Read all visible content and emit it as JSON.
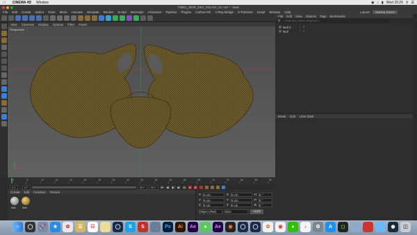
{
  "macos_menubar": {
    "app_name": "CINEMA 4D",
    "items": [
      "Window"
    ],
    "clock": "Wed 20:29"
  },
  "window": {
    "title": "TIME1_MOR_DEX_PELVIS_01.c4d * - Main"
  },
  "menu": {
    "items": [
      "File",
      "Edit",
      "Create",
      "Select",
      "Tools",
      "Mesh",
      "Animate",
      "Simulate",
      "Render",
      "Sculpt",
      "MoGraph",
      "Character",
      "Pipeline",
      "Plugins",
      "Carbon RE",
      "V-Ray Bridge",
      "X-Particles",
      "Script",
      "Window",
      "Help"
    ],
    "layout_label": "Layout:",
    "layout_value": "Startup (User)"
  },
  "viewport": {
    "menu": [
      "View",
      "Cameras",
      "Display",
      "Options",
      "Filter",
      "Panel"
    ],
    "camera_label": "Perspective",
    "bone_color": "#5a4a22",
    "background_top": "#4c4c4c",
    "background_bottom": "#616161"
  },
  "timeline": {
    "ticks": [
      "0",
      "5",
      "10",
      "15",
      "20",
      "25",
      "30",
      "35",
      "40",
      "45",
      "50",
      "55",
      "60",
      "65",
      "70",
      "75",
      "80",
      "85",
      "90"
    ],
    "current_frame": "0 F",
    "start_frame": "0 F",
    "end_frame": "90 F",
    "min_field": "0 F",
    "max_field": "90 F"
  },
  "material_manager": {
    "menu": [
      "Create",
      "Edit",
      "Function",
      "Texture"
    ],
    "materials": [
      {
        "label": "Mat",
        "color": "#9a9a9a"
      },
      {
        "label": "Mat",
        "color": "#c8a04a"
      }
    ]
  },
  "coordinates": {
    "rows": [
      {
        "axis": "X",
        "pos": "0 cm",
        "axis2": "X",
        "size": "0 cm",
        "axis3": "H",
        "rot": "0 °"
      },
      {
        "axis": "Y",
        "pos": "0 cm",
        "axis2": "Y",
        "size": "0 cm",
        "axis3": "P",
        "rot": "0 °"
      },
      {
        "axis": "Z",
        "pos": "0 cm",
        "axis2": "Z",
        "size": "0 cm",
        "axis3": "B",
        "rot": "0 °"
      }
    ],
    "mode1": "Object (Rel)",
    "mode2": "Size",
    "apply_label": "Apply"
  },
  "object_manager": {
    "menu": [
      "File",
      "Edit",
      "View",
      "Objects",
      "Tags",
      "Bookmarks"
    ],
    "search_placeholder": "<<Enter your search string here>>",
    "objects": [
      {
        "name": "Null 2"
      },
      {
        "name": "Null"
      }
    ]
  },
  "attribute_manager": {
    "menu": [
      "Mode",
      "Edit",
      "User Data"
    ]
  }
}
